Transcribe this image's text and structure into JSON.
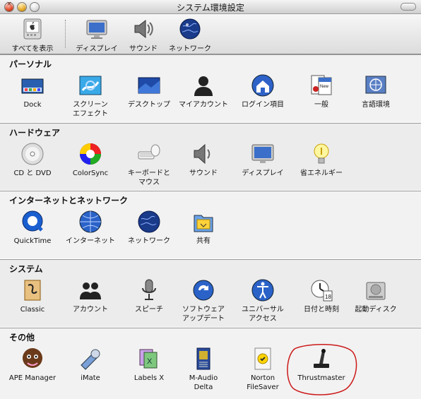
{
  "window": {
    "title": "システム環境設定"
  },
  "toolbar": {
    "show_all_label": "すべてを表示",
    "display_label": "ディスプレイ",
    "sound_label": "サウンド",
    "network_label": "ネットワーク"
  },
  "sections": [
    {
      "title": "パーソナル",
      "items": [
        {
          "label": "Dock",
          "icon": "dock-icon"
        },
        {
          "label": "スクリーン\nエフェクト",
          "icon": "screen-effects-icon"
        },
        {
          "label": "デスクトップ",
          "icon": "desktop-icon"
        },
        {
          "label": "マイアカウント",
          "icon": "my-account-icon"
        },
        {
          "label": "ログイン項目",
          "icon": "login-items-icon"
        },
        {
          "label": "一般",
          "icon": "general-icon"
        },
        {
          "label": "言語環境",
          "icon": "international-icon"
        }
      ]
    },
    {
      "title": "ハードウェア",
      "items": [
        {
          "label": "CD と DVD",
          "icon": "cd-dvd-icon"
        },
        {
          "label": "ColorSync",
          "icon": "colorsync-icon"
        },
        {
          "label": "キーボードと\nマウス",
          "icon": "keyboard-mouse-icon"
        },
        {
          "label": "サウンド",
          "icon": "sound-icon"
        },
        {
          "label": "ディスプレイ",
          "icon": "display-icon"
        },
        {
          "label": "省エネルギー",
          "icon": "energy-saver-icon"
        }
      ]
    },
    {
      "title": "インターネットとネットワーク",
      "items": [
        {
          "label": "QuickTime",
          "icon": "quicktime-icon"
        },
        {
          "label": "インターネット",
          "icon": "internet-icon"
        },
        {
          "label": "ネットワーク",
          "icon": "network-icon"
        },
        {
          "label": "共有",
          "icon": "sharing-icon"
        }
      ]
    },
    {
      "title": "システム",
      "items": [
        {
          "label": "Classic",
          "icon": "classic-icon"
        },
        {
          "label": "アカウント",
          "icon": "accounts-icon"
        },
        {
          "label": "スピーチ",
          "icon": "speech-icon"
        },
        {
          "label": "ソフトウェア\nアップデート",
          "icon": "software-update-icon"
        },
        {
          "label": "ユニバーサル\nアクセス",
          "icon": "universal-access-icon"
        },
        {
          "label": "日付と時刻",
          "icon": "date-time-icon"
        },
        {
          "label": "起動ディスク",
          "icon": "startup-disk-icon"
        }
      ]
    },
    {
      "title": "その他",
      "items": [
        {
          "label": "APE Manager",
          "icon": "ape-manager-icon"
        },
        {
          "label": "iMate",
          "icon": "imate-icon"
        },
        {
          "label": "Labels X",
          "icon": "labels-x-icon"
        },
        {
          "label": "M-Audio\nDelta",
          "icon": "m-audio-delta-icon"
        },
        {
          "label": "Norton\nFileSaver",
          "icon": "norton-filesaver-icon"
        },
        {
          "label": "Thrustmaster",
          "icon": "thrustmaster-icon"
        }
      ]
    }
  ],
  "colors": {
    "annotation_circle": "#cc1a1a"
  }
}
